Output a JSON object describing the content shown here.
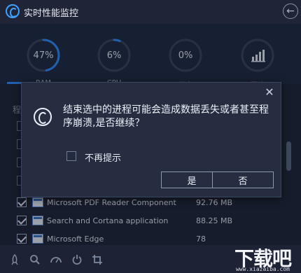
{
  "app": {
    "title": "实时性能监控"
  },
  "gauges": [
    {
      "value": "47%",
      "percent": 47,
      "label": "RAM",
      "color": "#2f8cff"
    },
    {
      "value": "6%",
      "percent": 6,
      "label": "CPU",
      "color": "#2f8cff"
    },
    {
      "value": "0%",
      "percent": 0,
      "label": "磁盘",
      "color": "#2f8cff"
    },
    {
      "value": "",
      "percent": 0,
      "label": "网速",
      "color": "#2f8cff",
      "icon": "bar-chart-icon"
    }
  ],
  "list": {
    "header": "程",
    "rows": [
      {
        "name": "Microsoft PDF Reader Component",
        "size": "92.76 MB",
        "checked": true
      },
      {
        "name": "Search and Cortana application",
        "size": "88.25 MB",
        "checked": true
      },
      {
        "name": "Microsoft Edge",
        "size": "78",
        "checked": true
      }
    ]
  },
  "dialog": {
    "message": "结束选中的进程可能会造成数据丢失或者甚至程序崩溃,是否继续？",
    "checkbox_label": "不再提示",
    "yes_label": "是",
    "no_label": "否",
    "close_icon": "close-icon",
    "logo_icon": "app-logo-icon"
  },
  "bottom_bar": {
    "icons": [
      "rocket-icon",
      "search-icon",
      "gauge-icon",
      "power-icon",
      "crop-icon"
    ]
  },
  "watermark": {
    "text": "下载吧",
    "url": "www.xiazaiba.com"
  },
  "colors": {
    "accent": "#2f8cff",
    "background": "#1b2132",
    "dialog": "#262d41"
  }
}
